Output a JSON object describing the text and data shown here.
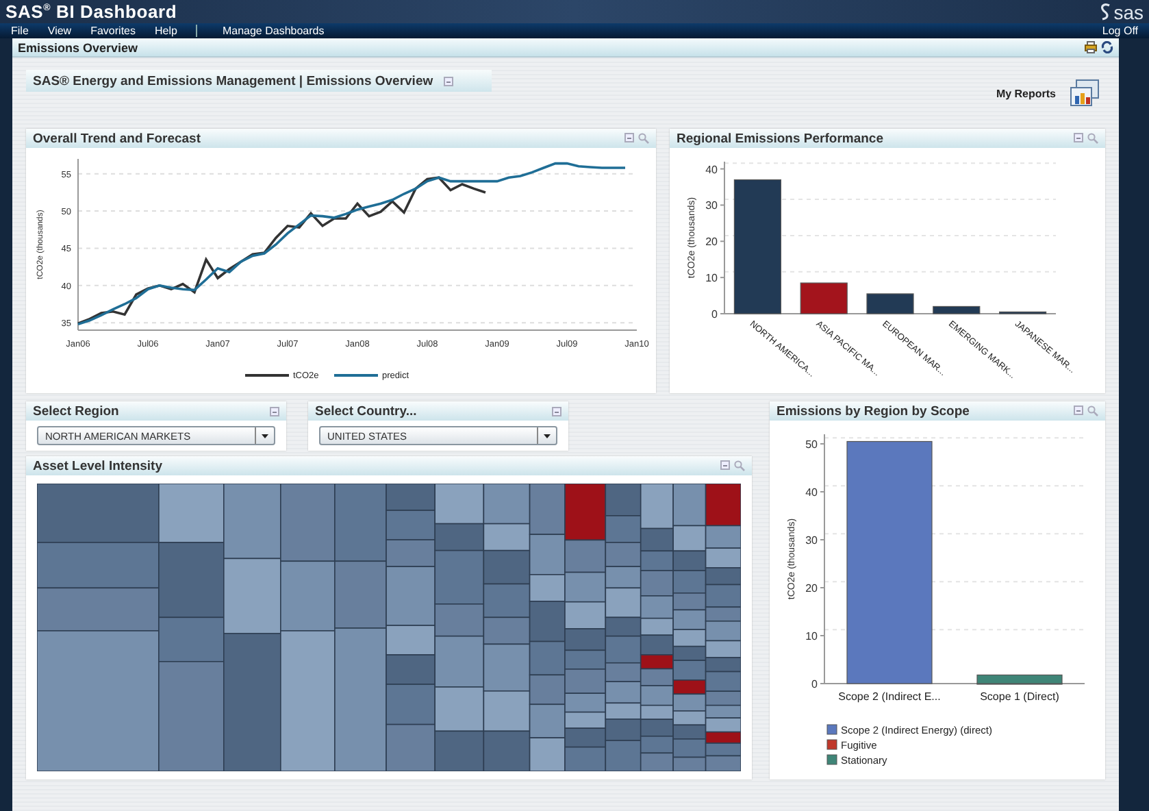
{
  "window": {
    "title": "SAS$^{®}$ BI Dashboard",
    "logo": "sas"
  },
  "menu": {
    "items": [
      "File",
      "View",
      "Favorites",
      "Help",
      "Manage Dashboards"
    ],
    "right": "Log Off"
  },
  "page_header": {
    "title": "Emissions Overview"
  },
  "subtitle": "SAS® Energy and Emissions Management | Emissions Overview",
  "my_reports": "My Reports",
  "trend": {
    "title": "Overall Trend and Forecast",
    "chart_data": {
      "type": "line",
      "ylabel": "tCO2e (thousands)",
      "grid": true,
      "legend": "bottom",
      "categories": [
        "Jan06",
        null,
        null,
        null,
        null,
        null,
        "Jul06",
        null,
        null,
        null,
        null,
        null,
        "Jan07",
        null,
        null,
        null,
        null,
        null,
        "Jul07",
        null,
        null,
        null,
        null,
        null,
        "Jan08",
        null,
        null,
        null,
        null,
        null,
        "Jul08",
        null,
        null,
        null,
        null,
        null,
        "Jan09",
        null,
        null,
        null,
        null,
        null,
        "Jul09",
        null,
        null,
        null,
        null,
        null,
        "Jan10"
      ],
      "ylim": [
        34,
        57
      ],
      "yticks": [
        35,
        40,
        45,
        50,
        55
      ],
      "series": [
        {
          "name": "tCO2e",
          "color": "#333333",
          "values": [
            34.9,
            35.5,
            36.3,
            36.5,
            36.1,
            38.8,
            39.6,
            40,
            39.5,
            40.2,
            39.1,
            43.5,
            41,
            42.2,
            43.2,
            44.2,
            44.4,
            46.4,
            48,
            47.8,
            49.7,
            48,
            49,
            49,
            51,
            49.3,
            49.9,
            51.3,
            49.8,
            53,
            54.3,
            54.5,
            52.8,
            53.6,
            53,
            52.5,
            null,
            null,
            null,
            null,
            null,
            null,
            null,
            null,
            null,
            null,
            null,
            null,
            null
          ]
        },
        {
          "name": "predict",
          "color": "#1f6e96",
          "values": [
            34.8,
            35.3,
            36,
            36.8,
            37.5,
            38.3,
            39.5,
            40,
            39.7,
            39.5,
            39.4,
            40.8,
            42.3,
            41.8,
            43.2,
            44,
            44.3,
            45.5,
            47,
            48.2,
            49.4,
            49.3,
            49.1,
            49.6,
            50.2,
            50.6,
            51,
            51.5,
            52.3,
            53,
            54,
            54.5,
            54,
            54,
            54,
            54,
            54,
            54.5,
            54.7,
            55.2,
            55.8,
            56.4,
            56.4,
            56,
            55.9,
            55.8,
            55.8,
            55.8,
            null
          ]
        }
      ]
    }
  },
  "regional": {
    "title": "Regional Emissions Performance",
    "chart_data": {
      "type": "bar",
      "ylabel": "tCO2e (thousands)",
      "categories": [
        "NORTH AMERICA...",
        "ASIA PACIFIC MA...",
        "EUROPEAN MAR...",
        "EMERGING MARK...",
        "JAPANESE MAR..."
      ],
      "ylim": [
        0,
        42
      ],
      "yticks": [
        0,
        10,
        20,
        30,
        40
      ],
      "stacked": true,
      "series": [
        {
          "color": "#223a55",
          "values": [
            37,
            null,
            5.5,
            2,
            0.5
          ]
        },
        {
          "color": "#a3141c",
          "values": [
            null,
            8.5,
            null,
            null,
            null
          ]
        }
      ]
    }
  },
  "selects": [
    {
      "label": "Select Region",
      "value": "NORTH AMERICAN MARKETS"
    },
    {
      "label": "Select Country...",
      "value": "UNITED STATES"
    }
  ],
  "asset": {
    "title": "Asset Level Intensity"
  },
  "scope": {
    "title": "Emissions by Region by Scope",
    "chart_data": {
      "type": "bar",
      "ylabel": "tCO2e (thousands)",
      "categories": [
        "Scope 2 (Indirect E...",
        "Scope 1 (Direct)"
      ],
      "ylim": [
        0,
        52
      ],
      "yticks": [
        0,
        10,
        20,
        30,
        40,
        50
      ],
      "stacked": true,
      "legend": "bottom",
      "series": [
        {
          "name": "Scope 2 (Indirect Energy) (direct)",
          "color": "#5b78bd",
          "values": [
            50.5,
            null
          ]
        },
        {
          "name": "Fugitive",
          "color": "#c0392b",
          "values": [
            null,
            0
          ]
        },
        {
          "name": "Stationary",
          "color": "#3f8577",
          "values": [
            null,
            1.8
          ]
        }
      ]
    }
  }
}
